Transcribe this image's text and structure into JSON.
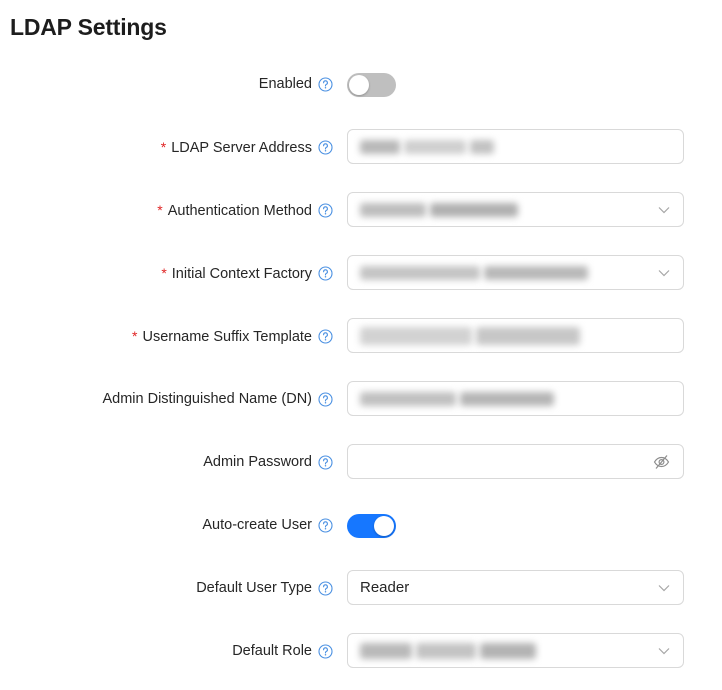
{
  "page": {
    "title": "LDAP Settings"
  },
  "colors": {
    "accent": "#1677ff",
    "required": "#e02424",
    "toggle_off": "#bfbfbf",
    "help": "#4a90e2"
  },
  "fields": {
    "enabled": {
      "label": "Enabled",
      "required": false,
      "type": "toggle",
      "checked": false
    },
    "server_address": {
      "label": "LDAP Server Address",
      "required": true,
      "type": "text",
      "value_redacted": true
    },
    "auth_method": {
      "label": "Authentication Method",
      "required": true,
      "type": "select",
      "value_redacted": true
    },
    "context_factory": {
      "label": "Initial Context Factory",
      "required": true,
      "type": "select",
      "value_redacted": true
    },
    "username_suffix": {
      "label": "Username Suffix Template",
      "required": true,
      "type": "text",
      "value_redacted": true
    },
    "admin_dn": {
      "label": "Admin Distinguished Name (DN)",
      "required": false,
      "type": "text",
      "value_redacted": true
    },
    "admin_password": {
      "label": "Admin Password",
      "required": false,
      "type": "password",
      "value": "",
      "icon": "eye-slash-icon"
    },
    "auto_create": {
      "label": "Auto-create User",
      "required": false,
      "type": "toggle",
      "checked": true
    },
    "default_user_type": {
      "label": "Default User Type",
      "required": false,
      "type": "select",
      "value": "Reader"
    },
    "default_role": {
      "label": "Default Role",
      "required": false,
      "type": "select",
      "value_redacted": true
    }
  },
  "required_marker": "*"
}
